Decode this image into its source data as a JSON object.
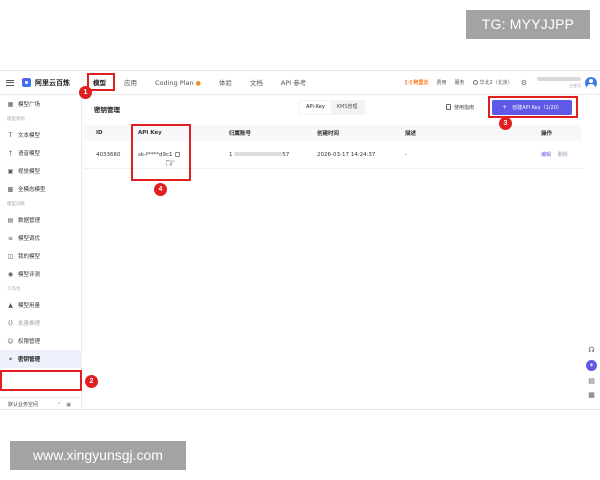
{
  "watermarks": {
    "tg": "TG: MYYJJPP",
    "site": "www.xingyunsgj.com"
  },
  "topnav": {
    "product": "阿里云百炼",
    "tabs": [
      {
        "label": "模型",
        "active": true
      },
      {
        "label": "应用",
        "active": false
      },
      {
        "label": "Coding Plan",
        "active": false
      },
      {
        "label": "体验",
        "active": false
      },
      {
        "label": "文档",
        "active": false
      },
      {
        "label": "API 参考",
        "active": false
      }
    ],
    "aliyun_link": "阿里云",
    "fee": "费用",
    "service": "服务",
    "region": "华北2（北京）",
    "account_role": "主账号"
  },
  "sidebar": {
    "items": [
      {
        "label": "模型广场",
        "icon": "grid-icon"
      },
      {
        "group": "模型体验"
      },
      {
        "label": "文本模型",
        "icon": "text-icon"
      },
      {
        "label": "语音模型",
        "icon": "voice-icon"
      },
      {
        "label": "视觉模型",
        "icon": "image-icon"
      },
      {
        "label": "全模态模型",
        "icon": "omni-icon"
      },
      {
        "group": "模型训练"
      },
      {
        "label": "数据管理",
        "icon": "data-icon"
      },
      {
        "label": "模型调优",
        "icon": "tune-icon"
      },
      {
        "label": "我的模型",
        "icon": "model-icon"
      },
      {
        "label": "模型评测",
        "icon": "eval-icon"
      },
      {
        "group": "工作台"
      },
      {
        "label": "模型用量",
        "icon": "usage-icon"
      },
      {
        "label": "批量推理",
        "icon": "batch-icon"
      },
      {
        "label": "权限管理",
        "icon": "user-icon"
      },
      {
        "label": "密钥管理",
        "icon": "key-icon"
      }
    ],
    "footer_label": "默认业务空间"
  },
  "main": {
    "title": "密钥管理",
    "segments": [
      "API-Key",
      "KMS管理"
    ],
    "active_segment": "API-Key",
    "guide_label": "使用指南",
    "create_label": "创建API Key（1/20）",
    "table": {
      "headers": {
        "id": "ID",
        "key": "API Key",
        "account": "归属账号",
        "created": "创建时间",
        "desc": "描述",
        "ops": "操作"
      },
      "rows": [
        {
          "id": "4033660",
          "key": "sk-f****d9c1",
          "account_prefix": "1",
          "account_suffix": "57",
          "created": "2026-03-17 14:24:37",
          "desc": "-",
          "edit": "编辑",
          "delete": "删除"
        }
      ]
    }
  },
  "annotations": [
    "1",
    "2",
    "3",
    "4"
  ],
  "colors": {
    "accent": "#6058e6",
    "annotation": "#e02020"
  }
}
